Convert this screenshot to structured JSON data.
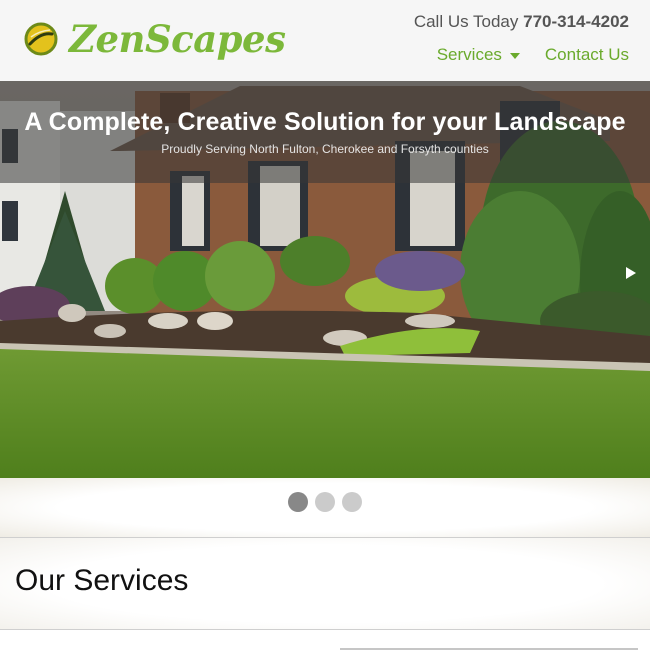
{
  "header": {
    "brand": "ZenScapes",
    "call_label": "Call Us Today",
    "phone": "770-314-4202",
    "nav": [
      {
        "label": "Services",
        "has_dropdown": true
      },
      {
        "label": "Contact Us",
        "has_dropdown": false
      }
    ]
  },
  "hero": {
    "title": "A Complete, Creative Solution for your Landscape",
    "subtitle": "Proudly Serving North Fulton, Cherokee and Forsyth counties",
    "next_icon": "triangle-right",
    "slides_total": 3,
    "active_slide": 1
  },
  "services": {
    "heading": "Our Services"
  },
  "colors": {
    "brand_green": "#7cb83a",
    "nav_green": "#6aaa2c",
    "header_bg": "#f6f6f6",
    "dot_active": "#888888",
    "dot_inactive": "#cbcbcb"
  }
}
